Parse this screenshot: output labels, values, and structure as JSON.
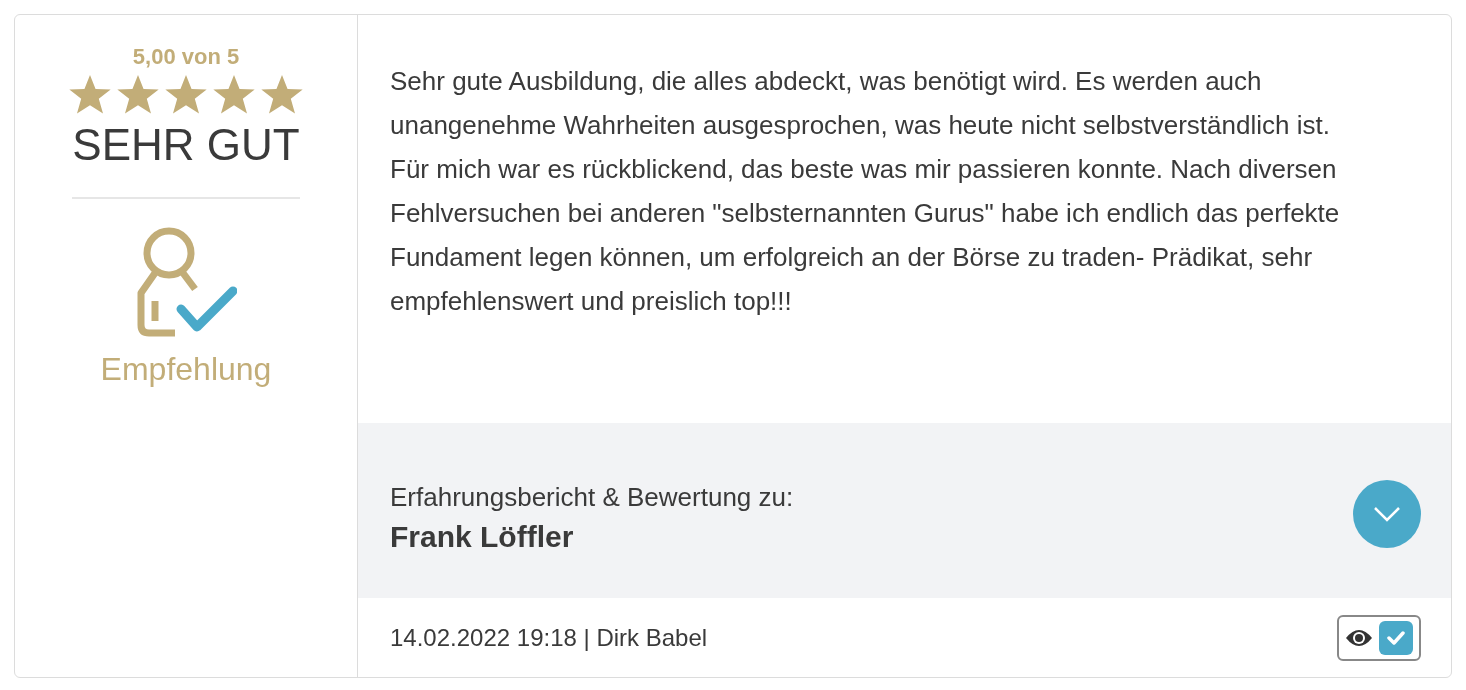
{
  "rating": {
    "score": "5,00 von 5",
    "stars": 5,
    "verdict": "SEHR GUT",
    "recommendation": "Empfehlung"
  },
  "review": {
    "paragraphs": [
      "Sehr gute Ausbildung, die alles abdeckt, was benötigt wird. Es werden auch unangenehme Wahrheiten ausgesprochen, was heute nicht selbstverständlich ist.",
      "Für mich war es rückblickend, das beste was mir passieren konnte. Nach diversen Fehlversuchen bei anderen \"selbsternannten Gurus\" habe ich endlich das perfekte Fundament legen können, um erfolgreich an der Börse zu traden- Prädikat, sehr empfehlenswert und preislich top!!!"
    ]
  },
  "subject": {
    "label": "Erfahrungsbericht & Bewertung zu:",
    "name": "Frank Löffler",
    "expanded": false
  },
  "footer": {
    "meta": "14.02.2022 19:18 | Dirk Babel",
    "verified": true
  }
}
